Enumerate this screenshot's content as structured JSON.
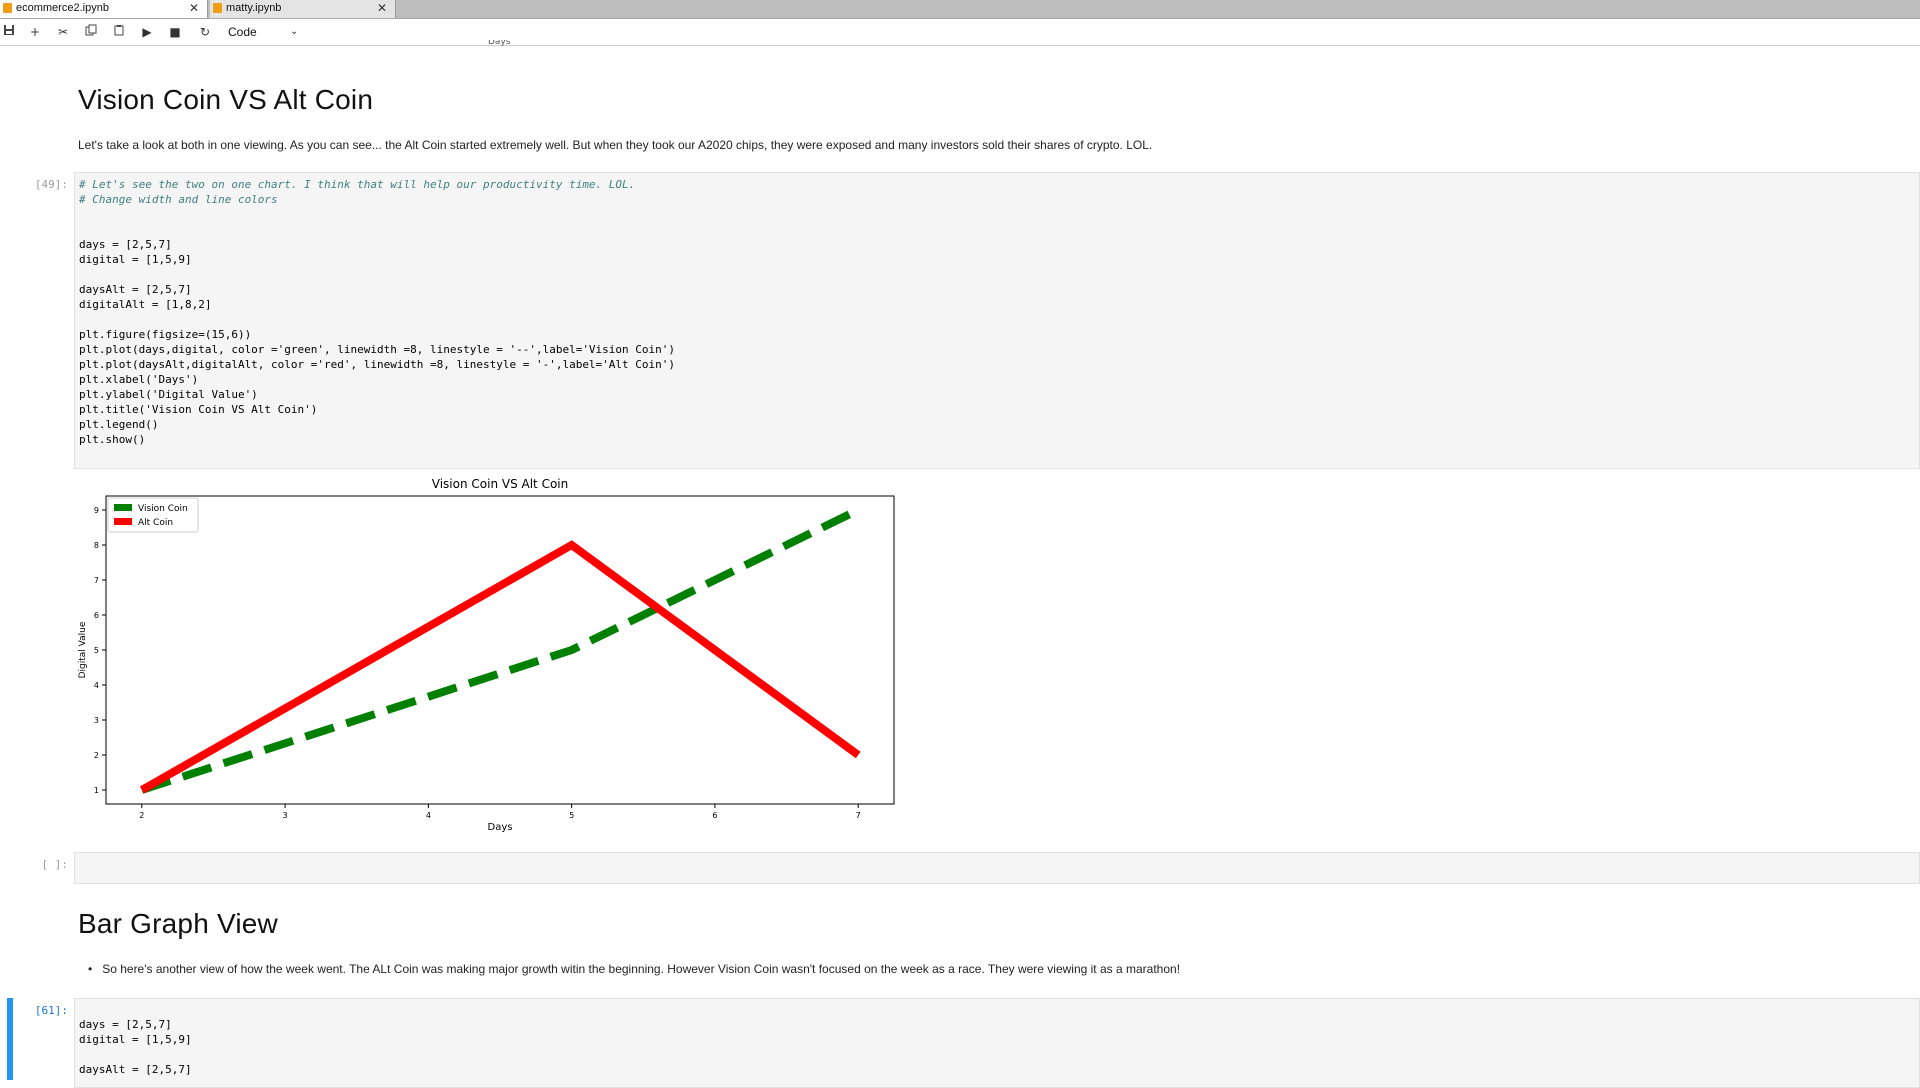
{
  "tabs": [
    {
      "label": "ecommerce2.ipynb",
      "active": true
    },
    {
      "label": "matty.ipynb",
      "active": false
    }
  ],
  "toolbar": {
    "icons": [
      "save-icon",
      "add-icon",
      "cut-icon",
      "copy-icon",
      "paste-icon",
      "run-icon",
      "stop-icon",
      "restart-icon"
    ],
    "cell_type": "Code"
  },
  "clipped_label": "Days",
  "section1": {
    "heading": "Vision Coin VS Alt Coin",
    "paragraph": "Let's take a look at both in one viewing. As you can see... the Alt Coin started extremely well. But when they took our A2020 chips, they were exposed and many investors sold their shares of crypto. LOL."
  },
  "cell49": {
    "prompt": "[49]:",
    "lines": [
      "# Let's see the two on one chart. I think that will help our productivity time. LOL.",
      "# Change width and line colors",
      "",
      "",
      "days = [2,5,7]",
      "digital = [1,5,9]",
      "",
      "daysAlt = [2,5,7]",
      "digitalAlt = [1,8,2]",
      "",
      "plt.figure(figsize=(15,6))",
      "plt.plot(days,digital, color ='green', linewidth =8, linestyle = '--',label='Vision Coin')",
      "plt.plot(daysAlt,digitalAlt, color ='red', linewidth =8, linestyle = '-',label='Alt Coin')",
      "plt.xlabel('Days')",
      "plt.ylabel('Digital Value')",
      "plt.title('Vision Coin VS Alt Coin')",
      "plt.legend()",
      "plt.show()"
    ]
  },
  "chart_data": {
    "type": "line",
    "title": "Vision Coin VS Alt Coin",
    "xlabel": "Days",
    "ylabel": "Digital Value",
    "xlim": [
      1.75,
      7.25
    ],
    "ylim": [
      0.6,
      9.4
    ],
    "xticks": [
      2,
      3,
      4,
      5,
      6,
      7
    ],
    "yticks": [
      1,
      2,
      3,
      4,
      5,
      6,
      7,
      8,
      9
    ],
    "grid": false,
    "legend": "top-left",
    "series": [
      {
        "name": "Vision Coin",
        "x": [
          2,
          5,
          7
        ],
        "y": [
          1,
          5,
          9
        ],
        "color": "#008000",
        "style": "dashed"
      },
      {
        "name": "Alt Coin",
        "x": [
          2,
          5,
          7
        ],
        "y": [
          1,
          8,
          2
        ],
        "color": "#ff0000",
        "style": "solid"
      }
    ]
  },
  "empty_cell": {
    "prompt": "[ ]:"
  },
  "section2": {
    "heading": "Bar Graph View",
    "bullet": "So here's another view of how the week went. The ALt Coin was making major growth witin the beginning. However Vision Coin wasn't focused on the week as a race. They were viewing it as a marathon!"
  },
  "cell61": {
    "prompt": "[61]:",
    "lines": [
      "days = [2,5,7]",
      "digital = [1,5,9]",
      "",
      "daysAlt = [2,5,7]"
    ]
  }
}
